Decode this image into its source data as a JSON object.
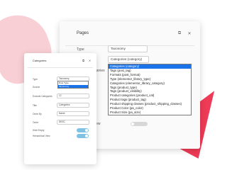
{
  "pages_panel": {
    "title": "Pages",
    "type_label": "Type",
    "type_value": "Taxonomy",
    "taxonomy_value": "Categories (category)",
    "partial_label": "gories",
    "hidden_label": "iew",
    "dropdown_options": [
      "Categories (category)",
      "Tags (post_tag)",
      "Formats (post_format)",
      "Type (elementor_library_type)",
      "Categories (elementor_library_category)",
      "Tags (product_type)",
      "Tags (product_visibility)",
      "Product categories (product_cat)",
      "Product tags (product_tag)",
      "Product shipping classes (product_shipping_classes)",
      "Product Color (pa_color)",
      "Product Size (pa_size)"
    ]
  },
  "categories_panel": {
    "title": "Categories",
    "rows": [
      {
        "label": "Type",
        "value": "Taxonomy"
      },
      {
        "label": "Source",
        "value": ""
      },
      {
        "label": "Exclude Categories",
        "value": "12"
      },
      {
        "label": "Title",
        "value": "Categories"
      },
      {
        "label": "Order By",
        "value": "Name"
      },
      {
        "label": "Order",
        "value": "DESC"
      }
    ],
    "dropdown_options": [
      "Post Type",
      "Taxonomy"
    ],
    "hide_empty_label": "Hide Empty",
    "hierarchical_label": "Hierarchical View"
  }
}
